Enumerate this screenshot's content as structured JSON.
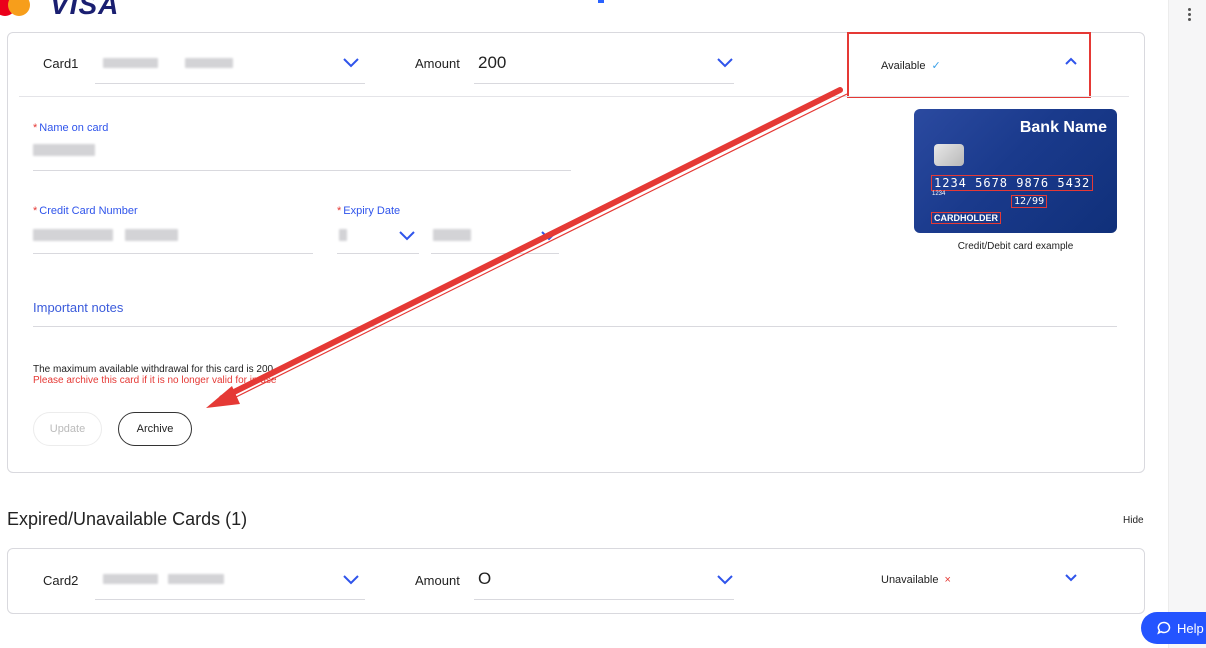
{
  "brand": {
    "visa_text": "VISA",
    "icon_mastercard": "mastercard-logo"
  },
  "active_card": {
    "card_label": "Card1",
    "amount_label": "Amount",
    "amount_value": "200",
    "status_text": "Available",
    "status_mark": "✓",
    "status_color": "#3aa0e8"
  },
  "form": {
    "name_label": "Name on card",
    "number_label": "Credit Card Number",
    "expiry_label": "Expiry Date",
    "required_mark": "*",
    "important_notes": "Important notes",
    "note_line1": "The maximum available withdrawal for this card is 200.",
    "note_line2": "Please archive this card if it is no longer valid for in use",
    "update_label": "Update",
    "archive_label": "Archive"
  },
  "card_example": {
    "bank_name": "Bank Name",
    "number": "1234 5678 9876 5432",
    "small_number": "1234",
    "expiry": "12/99",
    "holder": "CARDHOLDER",
    "caption": "Credit/Debit card example"
  },
  "expired_section": {
    "title": "Expired/Unavailable Cards (1)",
    "hide_label": "Hide",
    "card_label": "Card2",
    "amount_label": "Amount",
    "amount_value": "O",
    "status_text": "Unavailable",
    "status_mark": "×",
    "status_color": "#e53935"
  },
  "help": {
    "label": "Help"
  },
  "colors": {
    "accent": "#2f54eb",
    "annotation_red": "#e53935"
  }
}
